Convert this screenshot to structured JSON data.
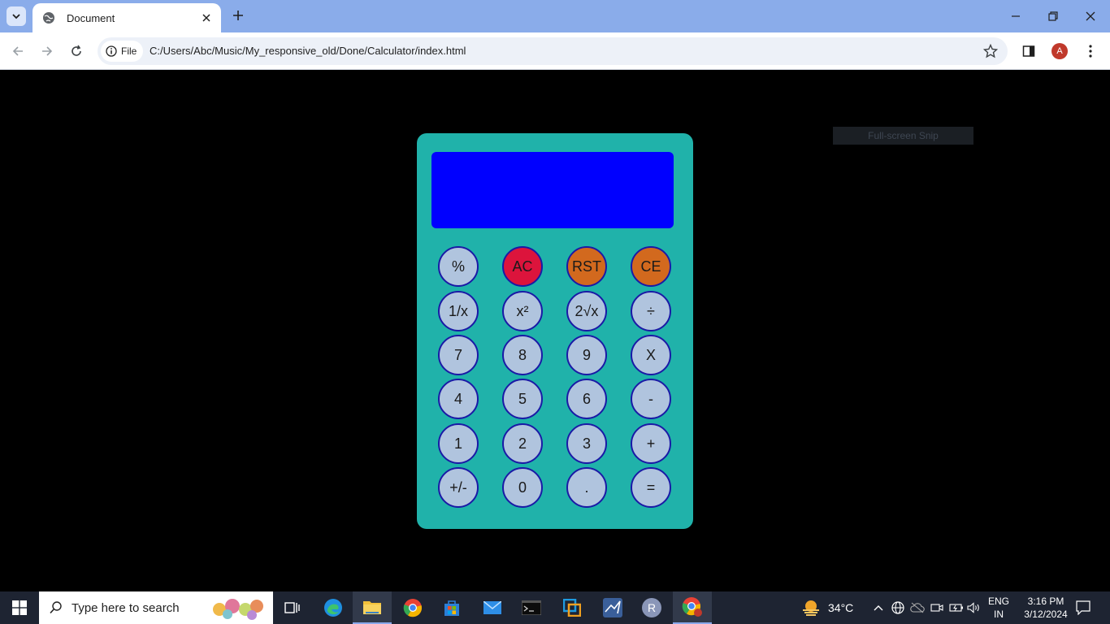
{
  "browser": {
    "tab_title": "Document",
    "address_chip": "File",
    "url": "C:/Users/Abc/Music/My_responsive_old/Done/Calculator/index.html",
    "profile_initial": "A"
  },
  "overlay": {
    "tooltip": "Full-screen Snip"
  },
  "calculator": {
    "display_value": "",
    "buttons": [
      {
        "label": "%",
        "style": "normal"
      },
      {
        "label": "AC",
        "style": "red"
      },
      {
        "label": "RST",
        "style": "orange"
      },
      {
        "label": "CE",
        "style": "orange"
      },
      {
        "label": "1/x",
        "style": "normal"
      },
      {
        "label": "x²",
        "style": "normal"
      },
      {
        "label": "2√x",
        "style": "normal"
      },
      {
        "label": "÷",
        "style": "normal"
      },
      {
        "label": "7",
        "style": "normal"
      },
      {
        "label": "8",
        "style": "normal"
      },
      {
        "label": "9",
        "style": "normal"
      },
      {
        "label": "X",
        "style": "normal"
      },
      {
        "label": "4",
        "style": "normal"
      },
      {
        "label": "5",
        "style": "normal"
      },
      {
        "label": "6",
        "style": "normal"
      },
      {
        "label": "-",
        "style": "normal"
      },
      {
        "label": "1",
        "style": "normal"
      },
      {
        "label": "2",
        "style": "normal"
      },
      {
        "label": "3",
        "style": "normal"
      },
      {
        "label": "+",
        "style": "normal"
      },
      {
        "label": "+/-",
        "style": "normal"
      },
      {
        "label": "0",
        "style": "normal"
      },
      {
        "label": ".",
        "style": "normal"
      },
      {
        "label": "=",
        "style": "normal"
      }
    ],
    "colors": {
      "body": "#20b2aa",
      "display": "#0000ff",
      "button": "#b0c4de",
      "button_red": "#dc143c",
      "button_orange": "#d2691e"
    }
  },
  "taskbar": {
    "search_placeholder": "Type here to search",
    "weather_temp": "34°C",
    "language_line1": "ENG",
    "language_line2": "IN",
    "time": "3:16 PM",
    "date": "3/12/2024",
    "apps": [
      "task-view-icon",
      "edge-icon",
      "file-explorer-icon",
      "chrome-icon",
      "microsoft-store-icon",
      "mail-icon",
      "terminal-icon",
      "remote-desktop-icon",
      "matlab-icon",
      "r-icon",
      "chrome-profile-icon"
    ],
    "r_label": "R"
  }
}
